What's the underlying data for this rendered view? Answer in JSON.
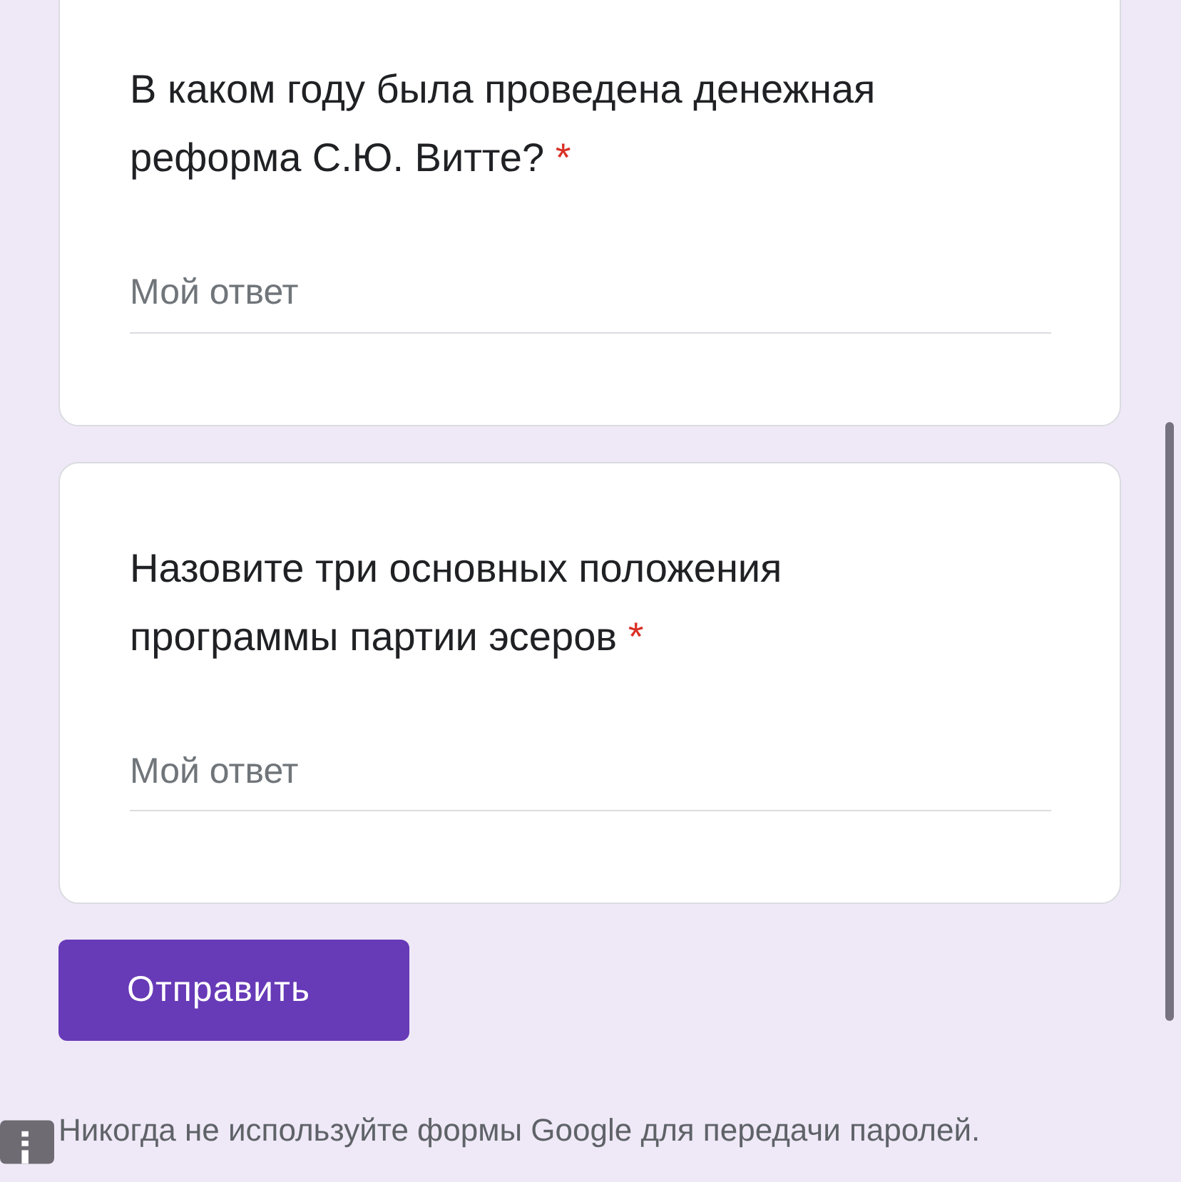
{
  "questions": [
    {
      "question": "В каком году была проведена денежная реформа С.Ю. Витте?",
      "required_mark": "*",
      "placeholder": "Мой ответ"
    },
    {
      "question": "Назовите три основных положения программы партии эсеров",
      "required_mark": "*",
      "placeholder": "Мой ответ"
    }
  ],
  "submit_button": "Отправить",
  "footer_note": "Никогда не используйте формы Google для передачи паролей."
}
